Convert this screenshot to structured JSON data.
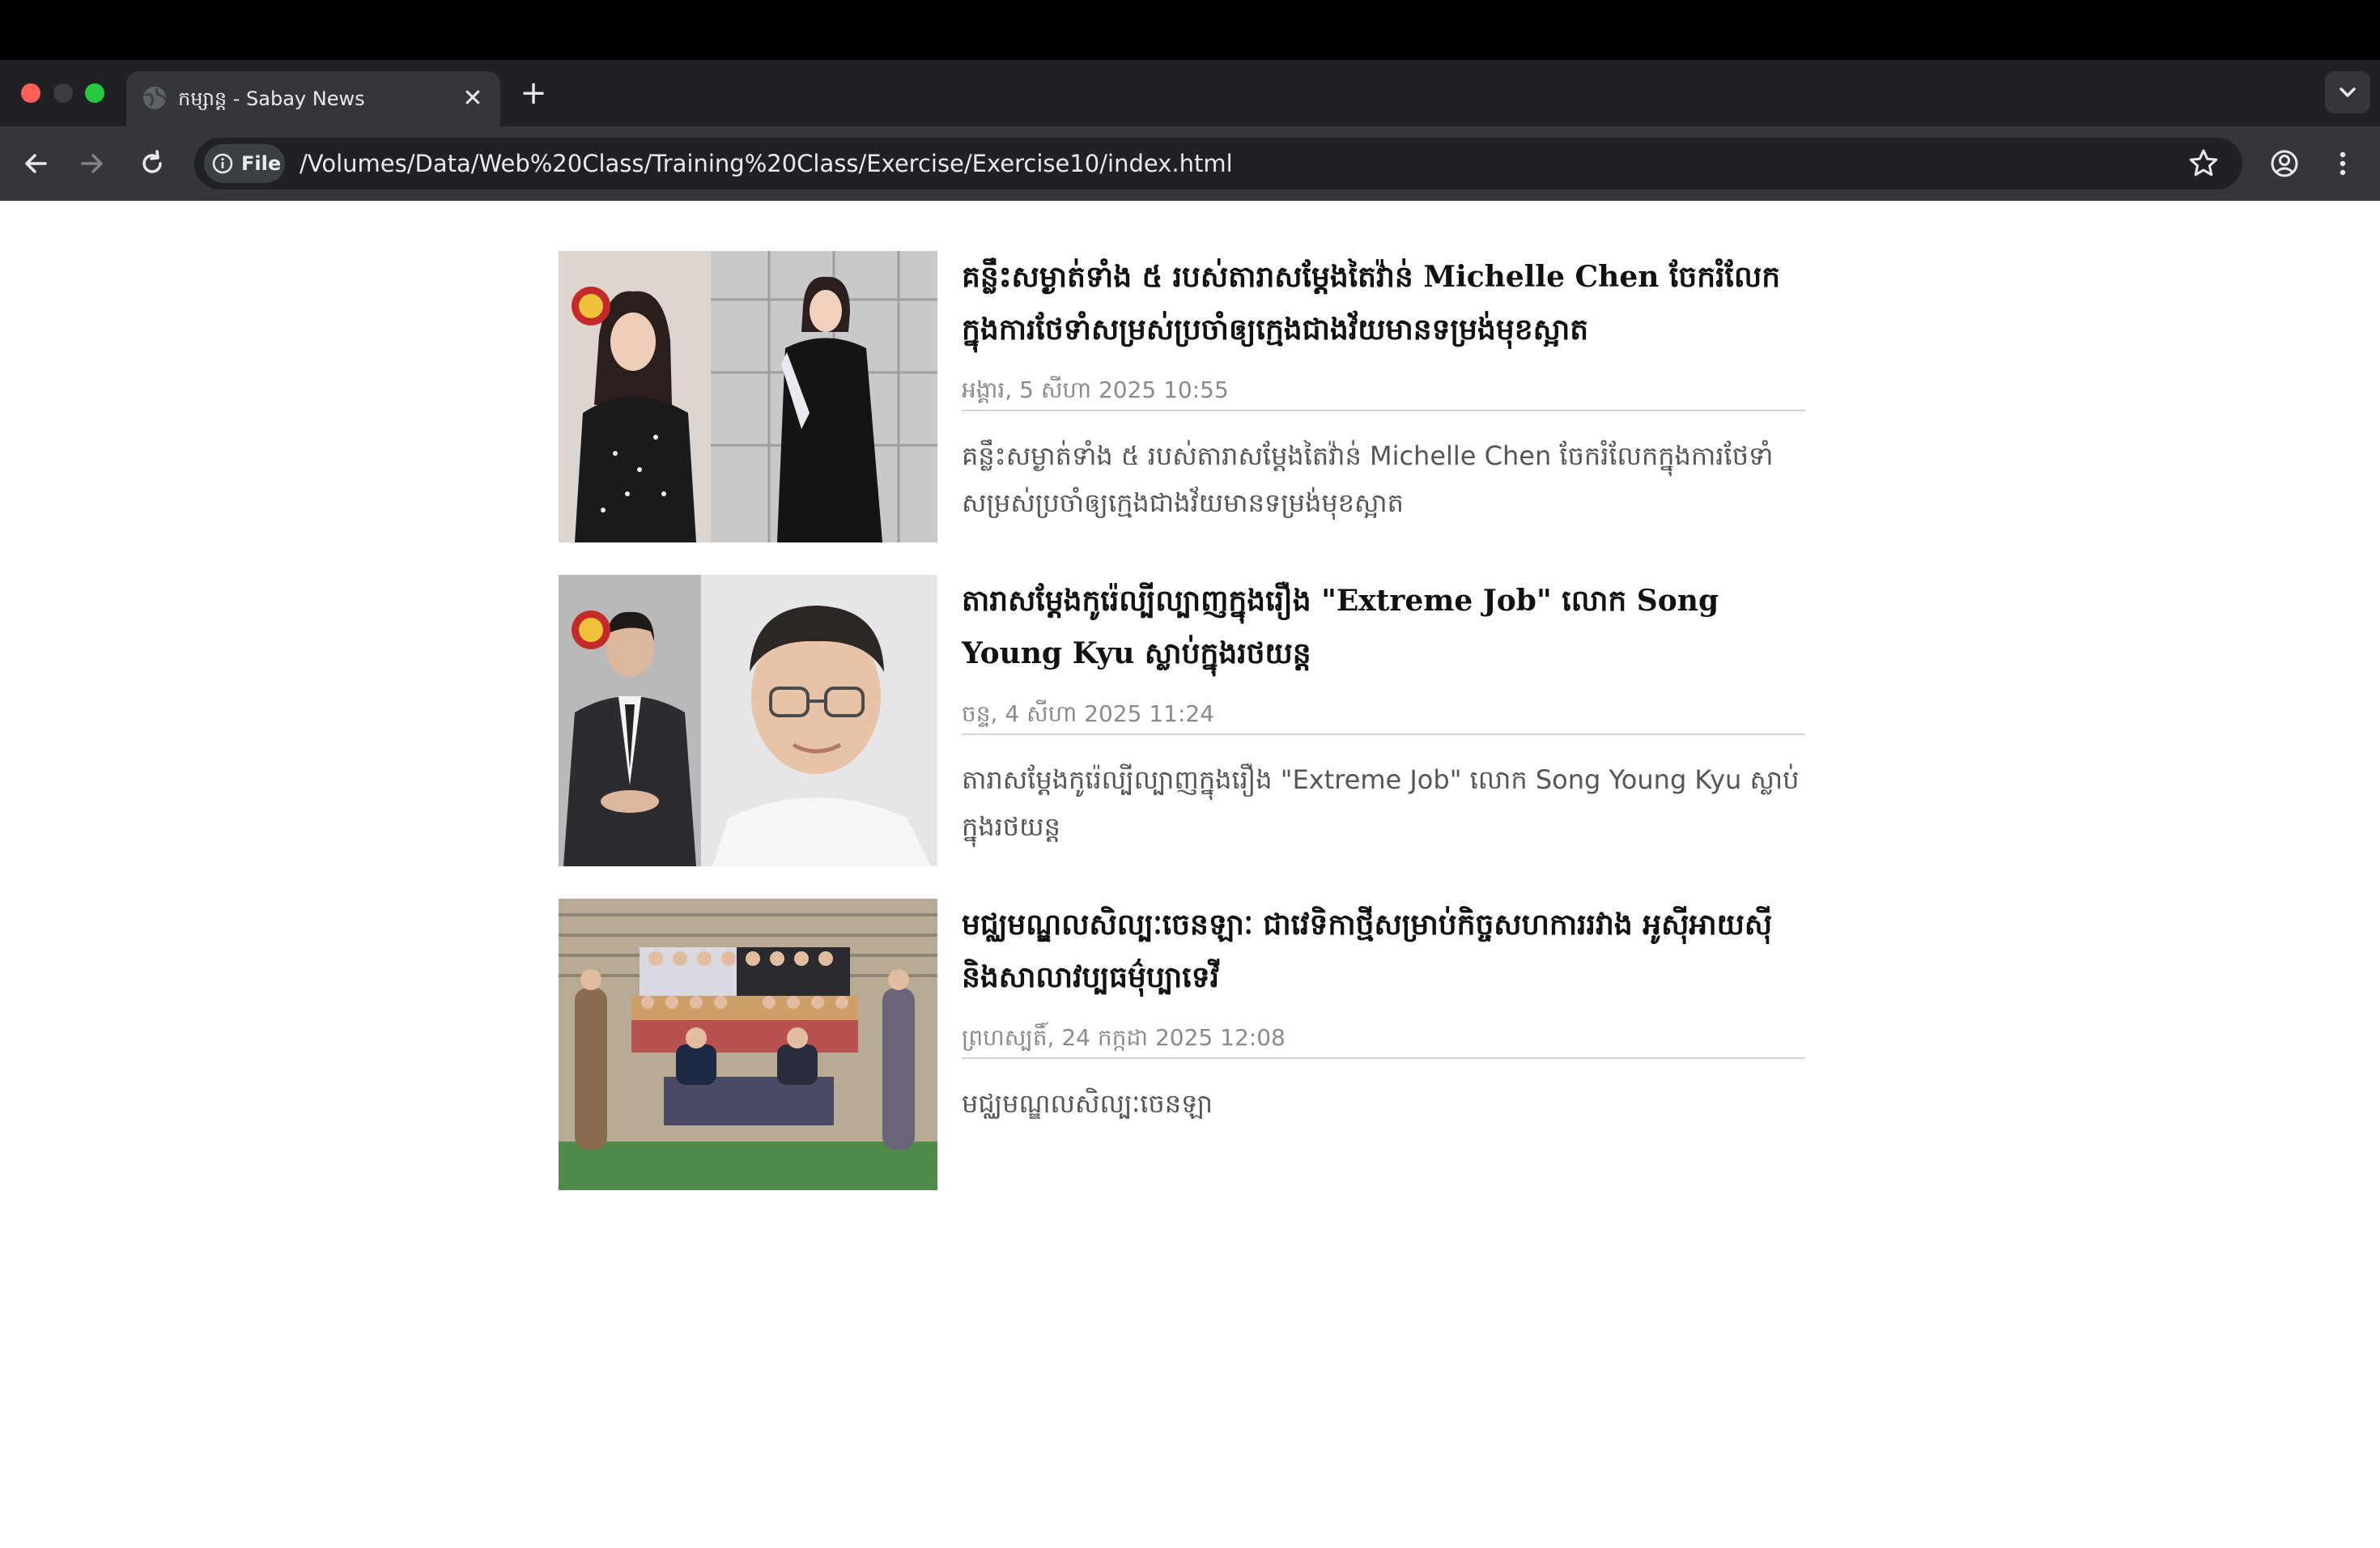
{
  "browser": {
    "tab_title": "កម្សាន្ត - Sabay News",
    "tab_close_symbol": "✕",
    "new_tab_symbol": "+",
    "site_info_label": "File",
    "url": "/Volumes/Data/Web%20Class/Training%20Class/Exercise/Exercise10/index.html"
  },
  "articles": [
    {
      "headline": "គន្លឹះសម្ងាត់ទាំង ៥ របស់តារាសម្ដែងតៃវ៉ាន់ Michelle Chen ចែករំលែកក្នុងការថែទាំសម្រស់ប្រចាំឲ្យក្មេងជាងវ័យមានទម្រង់មុខស្អាត",
      "date": "អង្គារ, 5 សីហា 2025 10:55",
      "summary": "គន្លឹះសម្ងាត់ទាំង ៥ របស់តារាសម្ដែងតៃវ៉ាន់ Michelle Chen ចែករំលែកក្នុងការថែទាំសម្រស់ប្រចាំឲ្យក្មេងជាងវ័យមានទម្រង់មុខស្អាត"
    },
    {
      "headline": "តារាសម្ដែងកូរ៉េល្បីល្បាញក្នុងរឿង \"Extreme Job\" លោក Song Young Kyu ស្លាប់ក្នុងរថយន្ត",
      "date": "ចន្ទ, 4 សីហា 2025 11:24",
      "summary": "តារាសម្ដែងកូរ៉េល្បីល្បាញក្នុងរឿង \"Extreme Job\" លោក Song Young Kyu ស្លាប់ក្នុងរថយន្ត"
    },
    {
      "headline": "មជ្ឈមណ្ឌលសិល្បៈចេនឡាៈ ជាវេទិកាថ្មីសម្រាប់កិច្ចសហការរវាង អូស៊ីអាយស៊ី និងសាលាវប្បធម៌ុប្បាទេវី",
      "date": "ព្រហស្បតិ៍, 24 កក្កដា 2025 12:08",
      "summary": "មជ្ឈមណ្ឌលសិល្បៈចេនឡា"
    }
  ]
}
